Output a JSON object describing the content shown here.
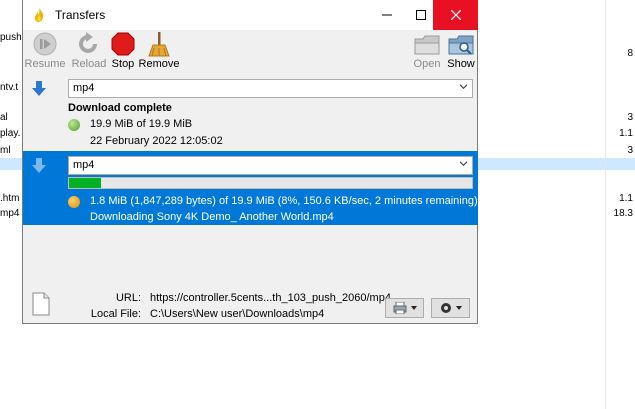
{
  "background": {
    "left_fragments": [
      "push",
      "ntv.t",
      "al",
      "play.",
      "ml",
      ".htm",
      "mp4"
    ],
    "right_fragments": [
      "8",
      "3",
      "1.1",
      "3",
      "1.1",
      "18.3"
    ]
  },
  "window": {
    "title": "Transfers",
    "app_icon": "tixati-flame-icon"
  },
  "toolbar": {
    "resume": "Resume",
    "reload": "Reload",
    "stop": "Stop",
    "remove": "Remove",
    "open": "Open",
    "show": "Show"
  },
  "transfers": [
    {
      "name": "mp4",
      "status_title": "Download complete",
      "size_text": "19.9 MiB of 19.9 MiB",
      "date_text": "22 February 2022 12:05:02",
      "status_color": "#6fbf3f"
    },
    {
      "name": "mp4",
      "progress_percent": 8,
      "status_line": "1.8 MiB (1,847,289 bytes) of 19.9 MiB (8%, 150.6 KB/sec, 2 minutes remaining)",
      "downloading_line": "Downloading Sony 4K Demo_ Another World.mp4",
      "status_color": "#f0a020"
    }
  ],
  "details": {
    "url_label": "URL:",
    "url_value": "https://controller.5cents...th_103_push_2060/mp4",
    "local_label": "Local File:",
    "local_value": "C:\\Users\\New user\\Downloads\\mp4"
  },
  "colors": {
    "selection": "#0078d7",
    "progress_fill": "#06b025",
    "close_button": "#e81123"
  }
}
